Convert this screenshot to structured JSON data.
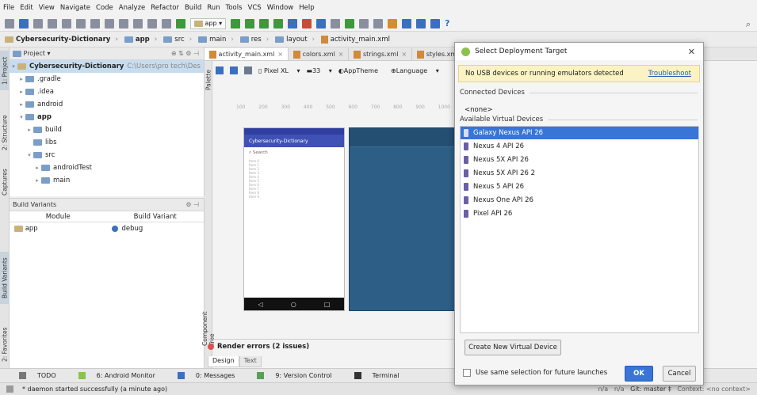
{
  "menu": [
    "File",
    "Edit",
    "View",
    "Navigate",
    "Code",
    "Analyze",
    "Refactor",
    "Build",
    "Run",
    "Tools",
    "VCS",
    "Window",
    "Help"
  ],
  "toolbar": {
    "run_config": "app",
    "help": "?"
  },
  "breadcrumbs": [
    "Cybersecurity-Dictionary",
    "app",
    "src",
    "main",
    "res",
    "layout",
    "activity_main.xml"
  ],
  "project_panel": {
    "title": "Project",
    "root_name": "Cybersecurity-Dictionary",
    "root_path": "C:\\Users\\pro tech\\Des",
    "tree": [
      {
        "label": ".gradle",
        "level": 1,
        "arrow": "▸"
      },
      {
        "label": ".idea",
        "level": 1,
        "arrow": "▸"
      },
      {
        "label": "android",
        "level": 1,
        "arrow": "▸"
      },
      {
        "label": "app",
        "level": 1,
        "arrow": "▾"
      },
      {
        "label": "build",
        "level": 2,
        "arrow": "▸"
      },
      {
        "label": "libs",
        "level": 2,
        "arrow": ""
      },
      {
        "label": "src",
        "level": 2,
        "arrow": "▾"
      },
      {
        "label": "androidTest",
        "level": 3,
        "arrow": "▸"
      },
      {
        "label": "main",
        "level": 3,
        "arrow": "▸"
      }
    ]
  },
  "build_variants": {
    "title": "Build Variants",
    "col_module": "Module",
    "col_variant": "Build Variant",
    "rows": [
      {
        "module": "app",
        "variant": "debug"
      }
    ]
  },
  "left_tabs": [
    "1: Project",
    "2: Structure",
    "Captures",
    "Build Variants",
    "2: Favorites"
  ],
  "editor_tabs": [
    "activity_main.xml",
    "colors.xml",
    "strings.xml",
    "styles.xml"
  ],
  "editor_toolbar": {
    "device": "Pixel XL",
    "api": "33",
    "theme": "AppTheme",
    "language": "Language"
  },
  "palette_label": "Palette",
  "component_tree_label": "Component Tree",
  "ruler": [
    "100",
    "200",
    "300",
    "400",
    "500",
    "600",
    "700",
    "800",
    "900",
    "1000"
  ],
  "phone_preview": {
    "app_title": "Cybersecurity-Dictionary",
    "search_hint": "Search",
    "items": [
      "Item 0",
      "Item 1",
      "Item 2",
      "Item 3",
      "Item 4",
      "Item 5",
      "Item 6",
      "Item 7",
      "Item 8",
      "Item 9"
    ]
  },
  "render_errors": "Render errors (2 issues)",
  "design_tabs": [
    "Design",
    "Text"
  ],
  "bottom_tools": [
    "TODO",
    "6: Android Monitor",
    "0: Messages",
    "9: Version Control",
    "Terminal"
  ],
  "status": {
    "message": "* daemon started successfully (a minute ago)",
    "na1": "n/a",
    "na2": "n/a",
    "git": "Git: master ‡",
    "context": "Context: <no context>"
  },
  "dialog": {
    "title": "Select Deployment Target",
    "warning": "No USB devices or running emulators detected",
    "troubleshoot": "Troubleshoot",
    "connected_label": "Connected Devices",
    "none": "<none>",
    "available_label": "Available Virtual Devices",
    "devices": [
      "Galaxy Nexus API 26",
      "Nexus 4 API 26",
      "Nexus 5X API 26",
      "Nexus 5X API 26 2",
      "Nexus 5 API 26",
      "Nexus One API 26",
      "Pixel API 26"
    ],
    "selected_index": 0,
    "create_button": "Create New Virtual Device",
    "checkbox_label": "Use same selection for future launches",
    "ok": "OK",
    "cancel": "Cancel"
  }
}
